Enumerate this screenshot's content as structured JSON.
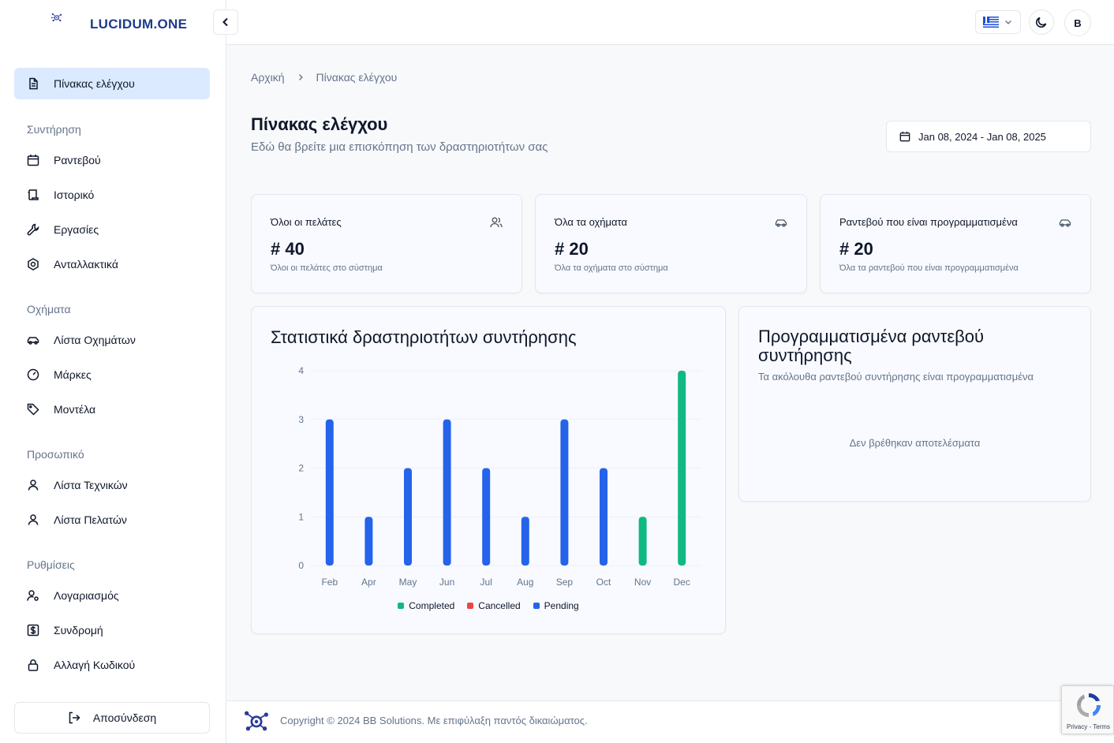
{
  "brand": {
    "name": "LUCIDUM.ONE"
  },
  "sidebar": {
    "active": {
      "label": "Πίνακας ελέγχου",
      "icon": "document-icon"
    },
    "sections": [
      {
        "title": "Συντήρηση",
        "items": [
          {
            "label": "Ραντεβού",
            "icon": "calendar-icon"
          },
          {
            "label": "Ιστορικό",
            "icon": "scroll-icon"
          },
          {
            "label": "Εργασίες",
            "icon": "wrench-icon"
          },
          {
            "label": "Ανταλλακτικά",
            "icon": "hexagon-icon"
          }
        ]
      },
      {
        "title": "Οχήματα",
        "items": [
          {
            "label": "Λίστα Οχημάτων",
            "icon": "car-icon"
          },
          {
            "label": "Μάρκες",
            "icon": "gauge-icon"
          },
          {
            "label": "Μοντέλα",
            "icon": "tag-icon"
          }
        ]
      },
      {
        "title": "Προσωπικό",
        "items": [
          {
            "label": "Λίστα Τεχνικών",
            "icon": "user-icon"
          },
          {
            "label": "Λίστα Πελατών",
            "icon": "user-icon"
          }
        ]
      },
      {
        "title": "Ρυθμίσεις",
        "items": [
          {
            "label": "Λογαριασμός",
            "icon": "user-cog-icon"
          },
          {
            "label": "Συνδρομή",
            "icon": "dollar-icon"
          },
          {
            "label": "Αλλαγή Κωδικού",
            "icon": "lock-icon"
          }
        ]
      }
    ],
    "logout": "Αποσύνδεση"
  },
  "header": {
    "avatar_initial": "B"
  },
  "breadcrumb": {
    "home": "Αρχική",
    "current": "Πίνακας ελέγχου"
  },
  "page": {
    "title": "Πίνακας ελέγχου",
    "subtitle": "Εδώ θα βρείτε μια επισκόπηση των δραστηριοτήτων σας",
    "date_range": "Jan 08, 2024 - Jan 08, 2025"
  },
  "stats": [
    {
      "title": "Όλοι οι πελάτες",
      "value": "# 40",
      "desc": "Όλοι οι πελάτες στο σύστημα",
      "icon": "users-icon"
    },
    {
      "title": "Όλα τα οχήματα",
      "value": "# 20",
      "desc": "Όλα τα οχήματα στο σύστημα",
      "icon": "car-icon"
    },
    {
      "title": "Ραντεβού που είναι προγραμματισμένα",
      "value": "# 20",
      "desc": "Όλα τα ραντεβού που είναι προγραμματισμένα",
      "icon": "car-icon"
    }
  ],
  "chart_card": {
    "title": "Στατιστικά δραστηριοτήτων συντήρησης"
  },
  "chart_data": {
    "type": "bar",
    "categories": [
      "Feb",
      "Apr",
      "May",
      "Jun",
      "Jul",
      "Aug",
      "Sep",
      "Oct",
      "Nov",
      "Dec"
    ],
    "series": [
      {
        "name": "Completed",
        "color": "#10b981",
        "values": [
          0,
          0,
          0,
          0,
          0,
          0,
          0,
          0,
          1,
          4
        ]
      },
      {
        "name": "Cancelled",
        "color": "#ef4444",
        "values": [
          0,
          0,
          0,
          0,
          0,
          0,
          0,
          0,
          0,
          0
        ]
      },
      {
        "name": "Pending",
        "color": "#2563eb",
        "values": [
          3,
          1,
          2,
          3,
          2,
          1,
          3,
          2,
          0,
          0
        ]
      }
    ],
    "yticks": [
      0,
      1,
      2,
      3,
      4
    ],
    "ylim": [
      0,
      4
    ],
    "grid": true,
    "legend": "bottom"
  },
  "scheduled": {
    "title": "Προγραμματισμένα ραντεβού συντήρησης",
    "subtitle": "Τα ακόλουθα ραντεβού συντήρησης είναι προγραμματισμένα",
    "empty": "Δεν βρέθηκαν αποτελέσματα"
  },
  "footer": {
    "copyright": "Copyright © 2024 BB Solutions. Με επιφύλαξη παντός δικαιώματος."
  },
  "recaptcha": {
    "text": "Privacy - Terms"
  }
}
